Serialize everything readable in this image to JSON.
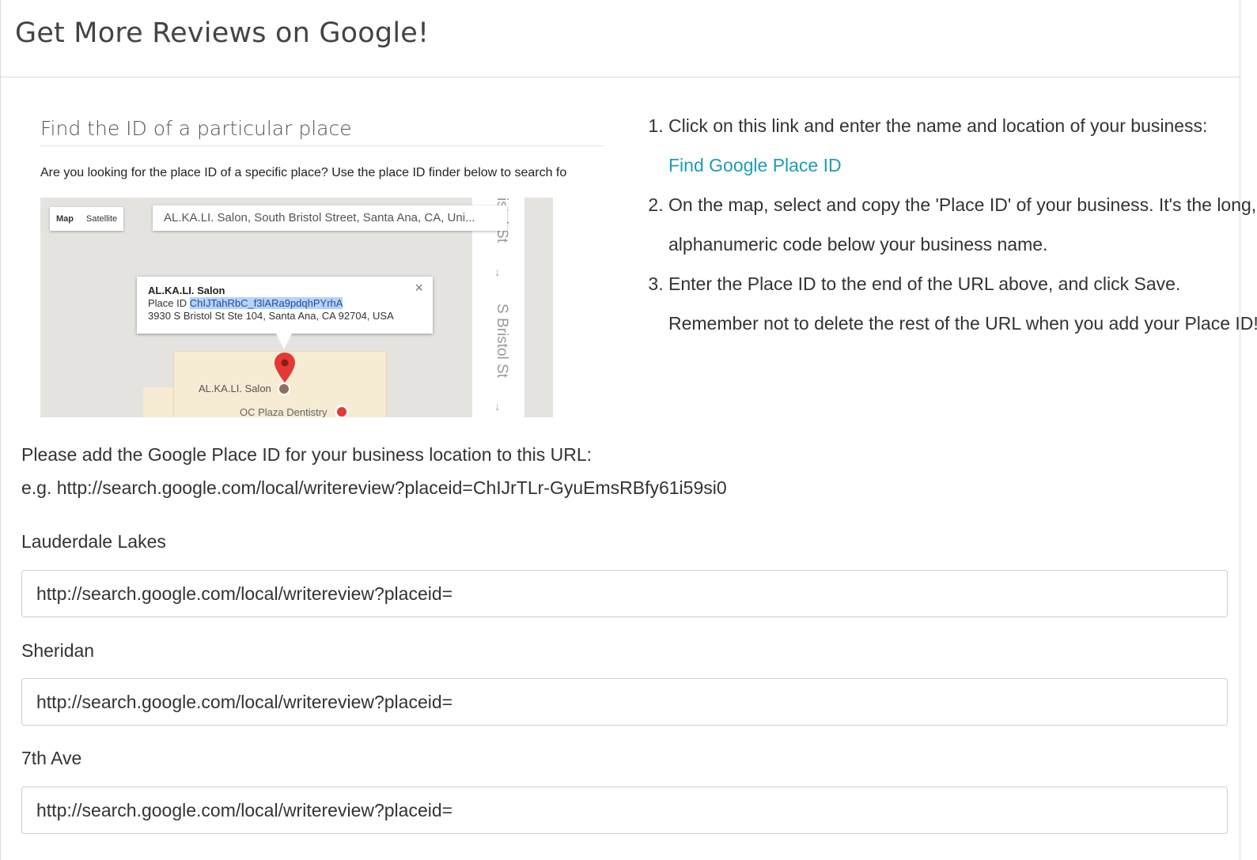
{
  "panel": {
    "title": "Get More Reviews on Google!"
  },
  "screenshot": {
    "heading": "Find the ID of a particular place",
    "description": "Are you looking for the place ID of a specific place? Use the place ID finder below to search fo",
    "map": {
      "type_map": "Map",
      "type_satellite": "Satellite",
      "search_text": "AL.KA.LI. Salon, South Bristol Street, Santa Ana, CA, Uni...",
      "street_top": "istol St",
      "street_main": "S Bristol St",
      "arrow": "↓",
      "info": {
        "name": "AL.KA.LI. Salon",
        "place_id_label": "Place ID",
        "place_id_value": "ChIJTahRbC_f3lARa9pdqhPYrhA",
        "address": "3930 S Bristol St Ste 104, Santa Ana, CA 92704, USA",
        "close": "×"
      },
      "poi_label": "AL.KA.LI. Salon",
      "poi_label2": "OC Plaza Dentistry"
    }
  },
  "instructions": {
    "step1": "Click on this link and enter the name and location of your business:",
    "step1_link": "Find Google Place ID",
    "step2": "On the map, select and copy the 'Place ID' of your business. It's the long, alphanumeric code below your business name.",
    "step3": "Enter the Place ID to the end of the URL above, and click Save. Remember not to delete the rest of the URL when you add your Place ID!"
  },
  "help": {
    "line1": "Please add the Google Place ID for your business location to this URL:",
    "line2": "e.g. http://search.google.com/local/writereview?placeid=ChIJrTLr-GyuEmsRBfy61i59si0"
  },
  "locations": [
    {
      "label": "Lauderdale Lakes",
      "value": "http://search.google.com/local/writereview?placeid="
    },
    {
      "label": "Sheridan",
      "value": "http://search.google.com/local/writereview?placeid="
    },
    {
      "label": "7th Ave",
      "value": "http://search.google.com/local/writereview?placeid="
    }
  ],
  "colors": {
    "link": "#1e9bb8",
    "pin": "#e53935",
    "highlight": "#b6d3f7"
  }
}
